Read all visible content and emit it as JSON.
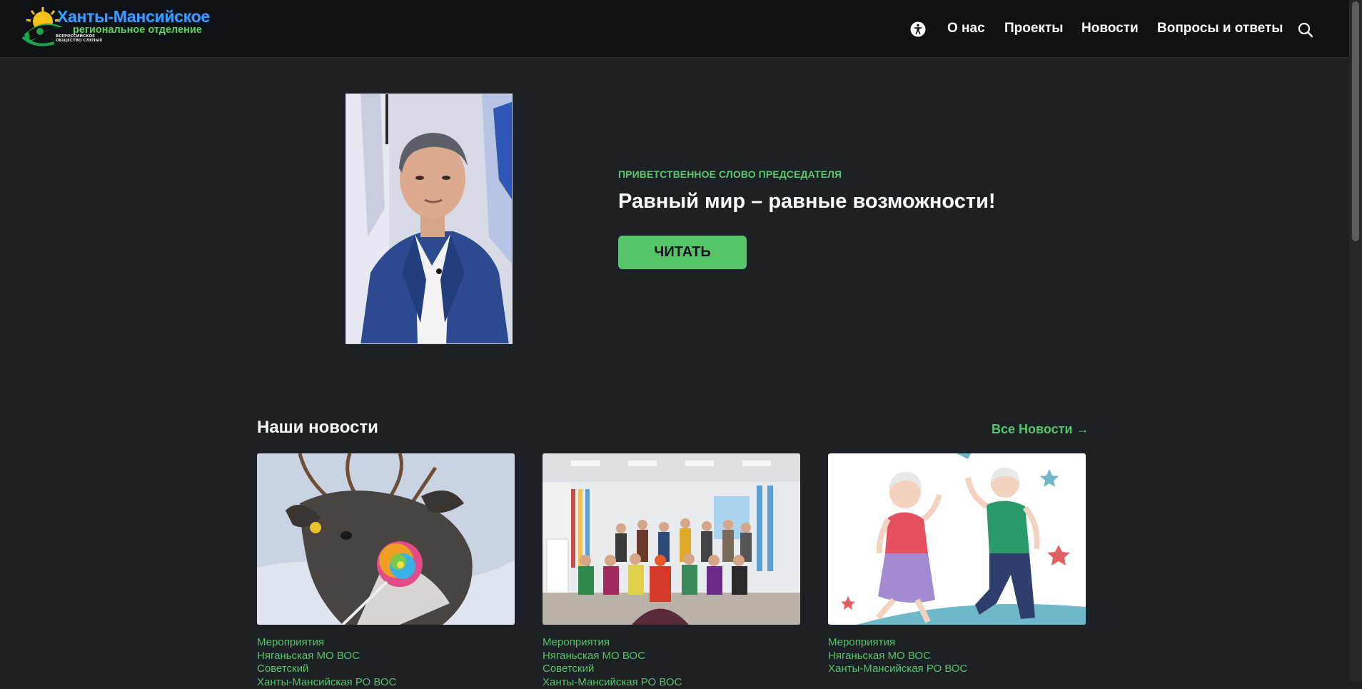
{
  "header": {
    "logo": {
      "title": "Ханты-Мансийское",
      "subtitle": "региональное отделение",
      "small_text": "ВСЕРОССИЙСКОЕ ОБЩЕСТВО СЛЕПЫХ"
    },
    "nav": [
      {
        "label": "О нас"
      },
      {
        "label": "Проекты"
      },
      {
        "label": "Новости"
      },
      {
        "label": "Вопросы и ответы"
      }
    ],
    "accessibility_icon": "accessibility-icon",
    "search_icon": "search-icon"
  },
  "hero": {
    "eyebrow": "ПРИВЕТСТВЕННОЕ СЛОВО ПРЕДСЕДАТЕЛЯ",
    "title": "Равный мир – равные возможности!",
    "button_label": "ЧИТАТЬ"
  },
  "news": {
    "heading": "Наши новости",
    "all_news_label": "Все Новости →",
    "cards": [
      {
        "tags": [
          "Мероприятия",
          "Няганьская МО ВОС",
          "Советский",
          "Ханты-Мансийская РО ВОС"
        ]
      },
      {
        "tags": [
          "Мероприятия",
          "Няганьская МО ВОС",
          "Советский",
          "Ханты-Мансийская РО ВОС"
        ]
      },
      {
        "tags": [
          "Мероприятия",
          "Няганьская МО ВОС",
          "Ханты-Мансийская РО ВОС"
        ]
      }
    ]
  },
  "colors": {
    "background": "#1d2024",
    "header": "#0e1116",
    "accent": "#55c56a",
    "logo_blue": "#3d9bff"
  }
}
